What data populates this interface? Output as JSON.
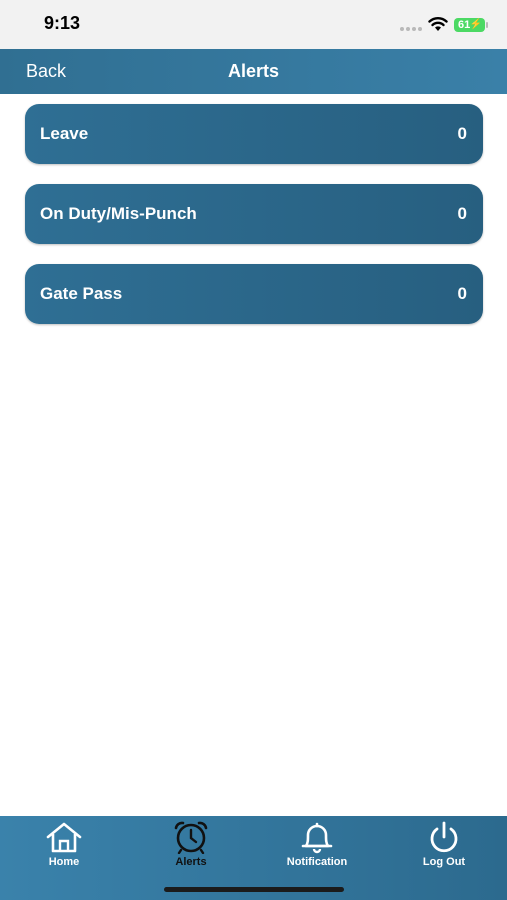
{
  "status": {
    "time": "9:13",
    "battery": "61"
  },
  "nav": {
    "back_label": "Back",
    "title": "Alerts"
  },
  "alerts": [
    {
      "label": "Leave",
      "count": "0"
    },
    {
      "label": "On Duty/Mis-Punch",
      "count": "0"
    },
    {
      "label": "Gate Pass",
      "count": "0"
    }
  ],
  "tabs": [
    {
      "label": "Home",
      "icon": "home-icon"
    },
    {
      "label": "Alerts",
      "icon": "alarm-clock-icon",
      "active": true
    },
    {
      "label": "Notification",
      "icon": "bell-icon"
    },
    {
      "label": "Log Out",
      "icon": "power-icon"
    }
  ],
  "colors": {
    "header": "#306f92",
    "row": "#2f6f94",
    "tab_bar": "#3a82ab",
    "active_tab": "#111111"
  }
}
